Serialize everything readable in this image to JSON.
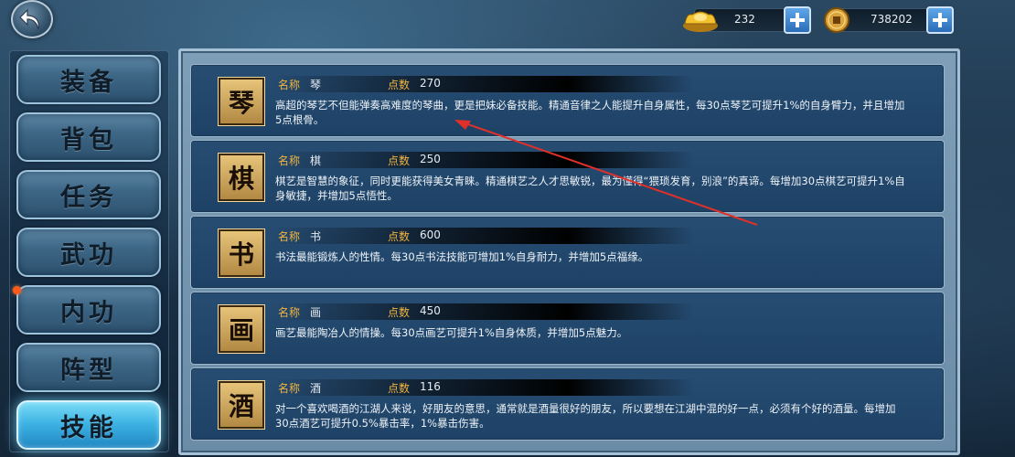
{
  "currency": {
    "gold_value": "232",
    "coins_value": "738202"
  },
  "nav": {
    "items": [
      {
        "label": "装备",
        "active": false
      },
      {
        "label": "背包",
        "active": false
      },
      {
        "label": "任务",
        "active": false
      },
      {
        "label": "武功",
        "active": false
      },
      {
        "label": "内功",
        "active": false,
        "badge": true
      },
      {
        "label": "阵型",
        "active": false
      },
      {
        "label": "技能",
        "active": true
      }
    ]
  },
  "skills": {
    "name_label": "名称",
    "points_label": "点数",
    "items": [
      {
        "icon_char": "琴",
        "name": "琴",
        "points": "270",
        "description": "高超的琴艺不但能弹奏高难度的琴曲，更是把妹必备技能。精通音律之人能提升自身属性，每30点琴艺可提升1%的自身臂力，并且增加5点根骨。"
      },
      {
        "icon_char": "棋",
        "name": "棋",
        "points": "250",
        "description": "棋艺是智慧的象征，同时更能获得美女青睐。精通棋艺之人才思敏锐，最为懂得“猥琐发育，别浪”的真谛。每增加30点棋艺可提升1%自身敏捷，并增加5点悟性。"
      },
      {
        "icon_char": "书",
        "name": "书",
        "points": "600",
        "description": "书法最能锻炼人的性情。每30点书法技能可增加1%自身耐力，并增加5点福缘。"
      },
      {
        "icon_char": "画",
        "name": "画",
        "points": "450",
        "description": "画艺最能陶冶人的情操。每30点画艺可提升1%自身体质，并增加5点魅力。"
      },
      {
        "icon_char": "酒",
        "name": "酒",
        "points": "116",
        "description": "对一个喜欢喝酒的江湖人来说，好朋友的意思，通常就是酒量很好的朋友，所以要想在江湖中混的好一点，必须有个好的酒量。每增加30点酒艺可提升0.5%暴击率，1%暴击伤害。"
      }
    ]
  },
  "colors": {
    "label_orange": "#f0b440",
    "active_tab": "#3fb4e4",
    "badge_gold": "#d8b060",
    "arrow_red": "#e0302a"
  },
  "icons": [
    "back-arrow-icon",
    "gold-ingot-icon",
    "copper-coin-icon",
    "plus-icon"
  ]
}
